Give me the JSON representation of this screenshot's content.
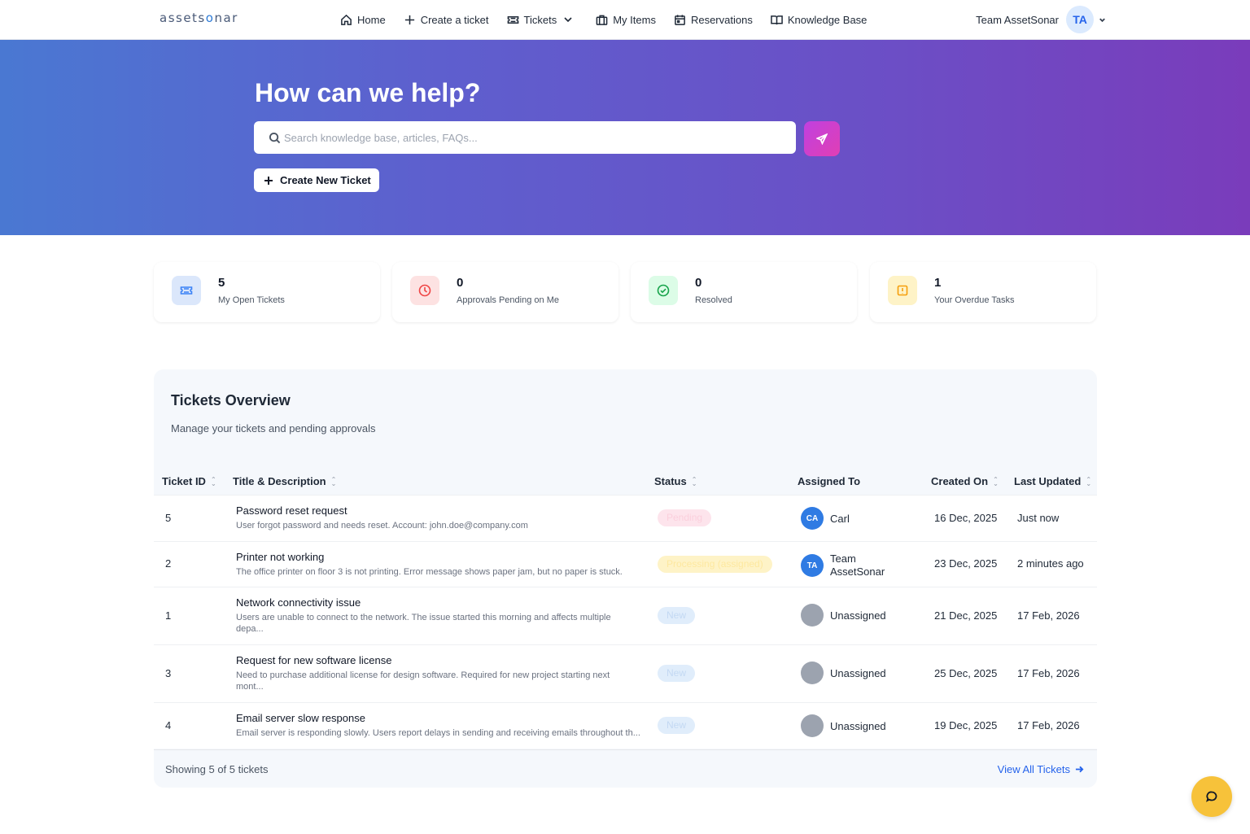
{
  "nav": {
    "logo_left": "assets",
    "logo_accent": "o",
    "logo_right": "nar",
    "items": [
      {
        "label": "Home",
        "icon": "home-icon"
      },
      {
        "label": "Create a ticket",
        "icon": "plus-icon"
      },
      {
        "label": "Tickets",
        "icon": "ticket-icon"
      },
      {
        "label": "My Items",
        "icon": "briefcase-icon"
      },
      {
        "label": "Reservations",
        "icon": "calendar-icon"
      },
      {
        "label": "Knowledge Base",
        "icon": "book-icon"
      }
    ],
    "user_name": "Team AssetSonar",
    "user_initials": "TA"
  },
  "hero": {
    "title": "How can we help?",
    "search_placeholder": "Search knowledge base, articles, FAQs...",
    "create_label": "Create New Ticket",
    "gradient_start": "#4a78d2",
    "gradient_end": "#7a3cbb"
  },
  "stats": [
    {
      "value": "5",
      "label": "My Open Tickets",
      "icon": "ticket-icon",
      "bg": "#dbe7fb",
      "color": "#3b82f6"
    },
    {
      "value": "0",
      "label": "Approvals Pending on Me",
      "icon": "clock-icon",
      "bg": "#fde2e2",
      "color": "#ef4444"
    },
    {
      "value": "0",
      "label": "Resolved",
      "icon": "check-circle-icon",
      "bg": "#dcfce7",
      "color": "#16a34a"
    },
    {
      "value": "1",
      "label": "Your Overdue Tasks",
      "icon": "alert-icon",
      "bg": "#fef3c7",
      "color": "#f59e0b"
    }
  ],
  "overview": {
    "title": "Tickets Overview",
    "subtitle": "Manage your tickets and pending approvals",
    "columns": [
      "Ticket ID",
      "Title & Description",
      "Status",
      "Assigned To",
      "Created On",
      "Last Updated"
    ],
    "rows": [
      {
        "id": "5",
        "title": "Password reset request",
        "desc": "User forgot password and needs reset. Account: john.doe@company.com",
        "status": "Pending",
        "assignee": "Carl",
        "initials": "CA",
        "created": "16 Dec, 2025",
        "updated": "Just now"
      },
      {
        "id": "2",
        "title": "Printer not working",
        "desc": "The office printer on floor 3 is not printing. Error message shows paper jam, but no paper is stuck.",
        "status": "Processing (assigned)",
        "assignee": "Team AssetSonar",
        "initials": "TA",
        "created": "23 Dec, 2025",
        "updated": "2 minutes ago"
      },
      {
        "id": "1",
        "title": "Network connectivity issue",
        "desc": "Users are unable to connect to the network. The issue started this morning and affects multiple depa...",
        "status": "New",
        "assignee": "Unassigned",
        "initials": "",
        "created": "21 Dec, 2025",
        "updated": "17 Feb, 2026"
      },
      {
        "id": "3",
        "title": "Request for new software license",
        "desc": "Need to purchase additional license for design software. Required for new project starting next mont...",
        "status": "New",
        "assignee": "Unassigned",
        "initials": "",
        "created": "25 Dec, 2025",
        "updated": "17 Feb, 2026"
      },
      {
        "id": "4",
        "title": "Email server slow response",
        "desc": "Email server is responding slowly. Users report delays in sending and receiving emails throughout th...",
        "status": "New",
        "assignee": "Unassigned",
        "initials": "",
        "created": "19 Dec, 2025",
        "updated": "17 Feb, 2026"
      }
    ],
    "footer_text": "Showing 5 of 5 tickets",
    "view_all_label": "View All Tickets"
  }
}
